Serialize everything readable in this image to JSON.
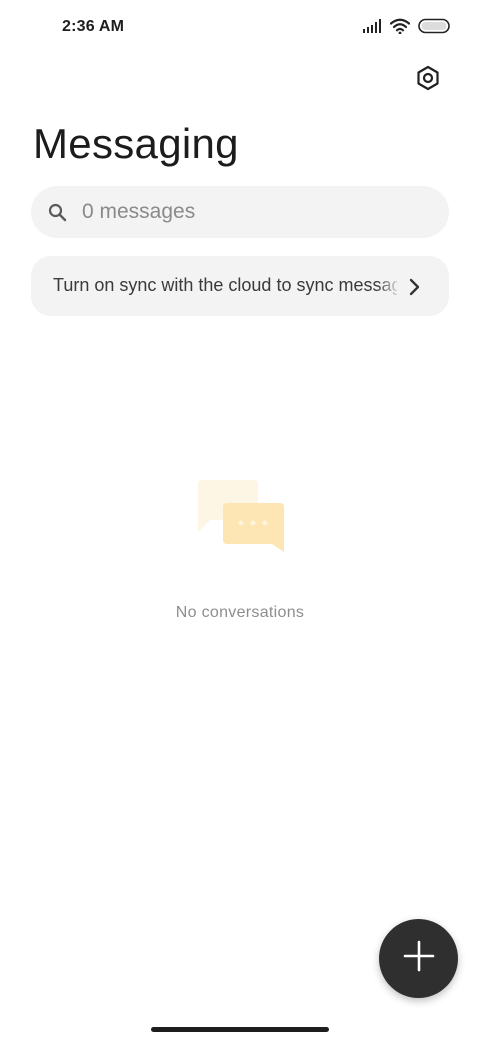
{
  "status_bar": {
    "time": "2:36 AM",
    "icons": [
      "signal-icon",
      "wifi-icon",
      "battery-icon"
    ]
  },
  "header": {
    "settings_icon": "settings-icon",
    "title": "Messaging"
  },
  "search": {
    "icon": "search-icon",
    "placeholder": "0 messages"
  },
  "sync_banner": {
    "text": "Turn on sync with the cloud to sync messages",
    "icon": "chevron-right-icon"
  },
  "empty_state": {
    "illustration": "chat-bubbles-icon",
    "text": "No conversations"
  },
  "fab": {
    "icon": "plus-icon"
  },
  "colors": {
    "background": "#ffffff",
    "surface": "#f3f3f3",
    "fab": "#2f2f2f",
    "illustration_light": "#fef6e4",
    "illustration_dark": "#fde6b4"
  }
}
